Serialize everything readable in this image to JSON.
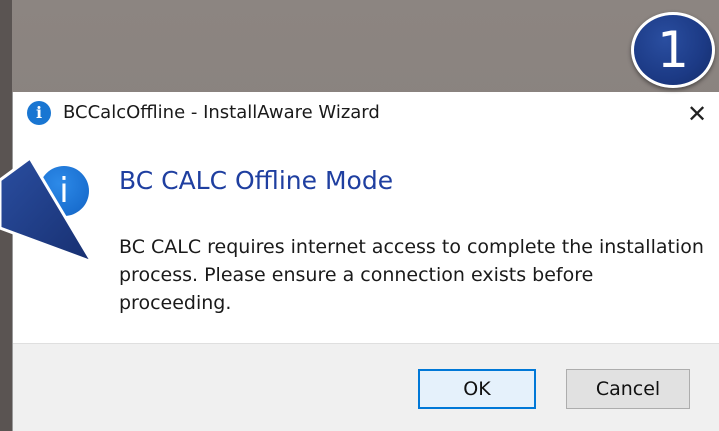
{
  "window": {
    "title": "BCCalcOffline - InstallAware Wizard",
    "close_glyph": "✕",
    "title_icon": "info-icon"
  },
  "callout": {
    "badge_number": "1",
    "badge_color": "#1c3a85"
  },
  "dialog": {
    "icon": "info-icon",
    "icon_glyph": "i",
    "heading": "BC CALC Offline Mode",
    "heading_color": "#1f3fa0",
    "message": "BC CALC requires internet access to complete the installation process.  Please ensure a connection exists before proceeding."
  },
  "buttons": {
    "ok_label": "OK",
    "cancel_label": "Cancel"
  }
}
